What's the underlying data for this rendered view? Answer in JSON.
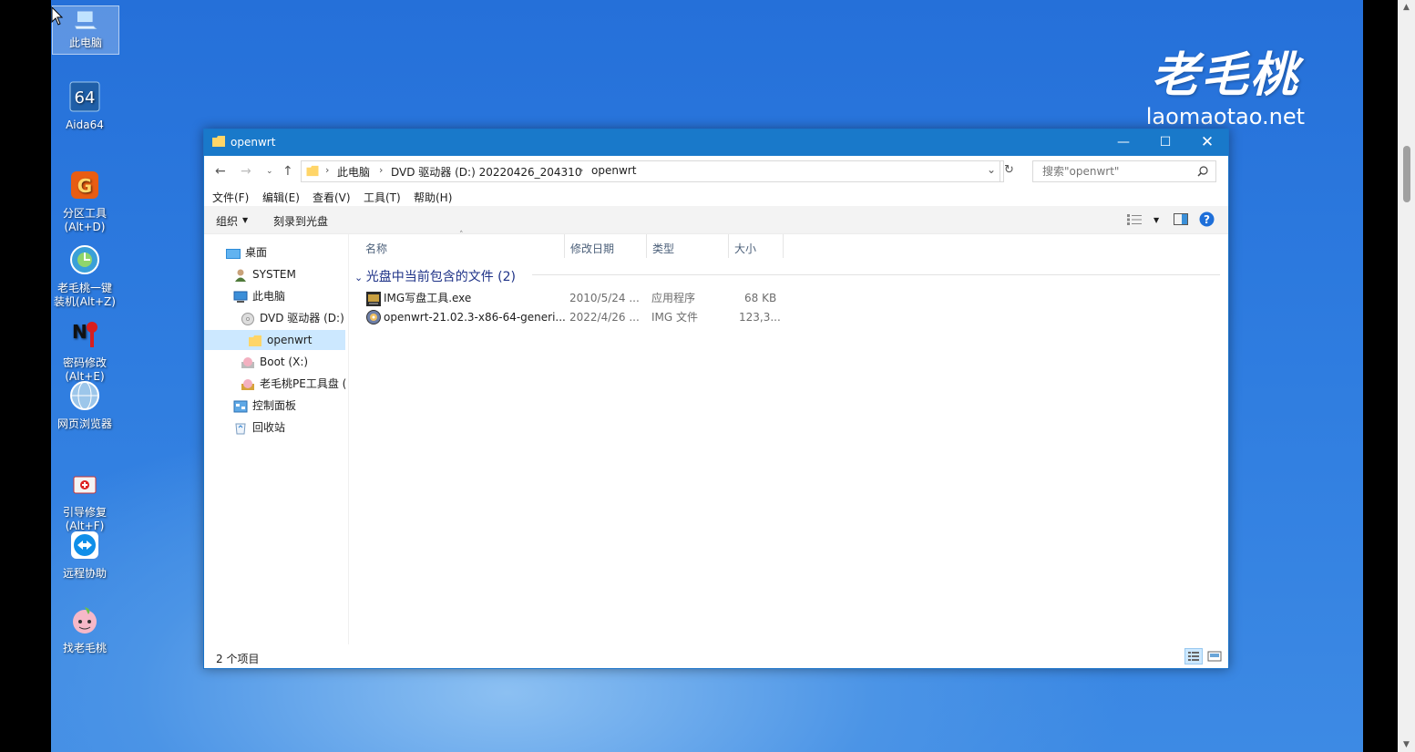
{
  "desktop": {
    "icons": [
      {
        "label": "此电脑",
        "icon": "this-pc-icon"
      },
      {
        "label": "Aida64",
        "icon": "aida64-icon"
      },
      {
        "label": "分区工具\n(Alt+D)",
        "icon": "partition-tool-icon"
      },
      {
        "label": "老毛桃一键\n装机(Alt+Z)",
        "icon": "one-key-install-icon"
      },
      {
        "label": "密码修改\n(Alt+E)",
        "icon": "password-change-icon"
      },
      {
        "label": "网页浏览器",
        "icon": "web-browser-icon"
      },
      {
        "label": "引导修复\n(Alt+F)",
        "icon": "boot-repair-icon"
      },
      {
        "label": "远程协助",
        "icon": "remote-assist-icon"
      },
      {
        "label": "找老毛桃",
        "icon": "find-laomaotao-icon"
      }
    ],
    "brand_cn": "老毛桃",
    "brand_url": "laomaotao.net"
  },
  "window": {
    "title": "openwrt",
    "breadcrumb": [
      "此电脑",
      "DVD 驱动器 (D:) 20220426_204310",
      "openwrt"
    ],
    "search_placeholder": "搜索\"openwrt\"",
    "menu": [
      "文件(F)",
      "编辑(E)",
      "查看(V)",
      "工具(T)",
      "帮助(H)"
    ],
    "commands": {
      "organize": "组织",
      "burn": "刻录到光盘"
    },
    "nav_tree": [
      {
        "label": "桌面",
        "icon": "desktop-folder-icon"
      },
      {
        "label": "SYSTEM",
        "icon": "user-icon"
      },
      {
        "label": "此电脑",
        "icon": "computer-icon"
      },
      {
        "label": "DVD 驱动器 (D:)",
        "icon": "dvd-drive-icon"
      },
      {
        "label": "openwrt",
        "icon": "folder-icon"
      },
      {
        "label": "Boot (X:)",
        "icon": "boot-drive-icon"
      },
      {
        "label": "老毛桃PE工具盘 (",
        "icon": "pe-drive-icon"
      },
      {
        "label": "控制面板",
        "icon": "control-panel-icon"
      },
      {
        "label": "回收站",
        "icon": "recycle-bin-icon"
      }
    ],
    "columns": {
      "name": "名称",
      "date": "修改日期",
      "type": "类型",
      "size": "大小"
    },
    "group_label": "光盘中当前包含的文件 (2)",
    "files": [
      {
        "name": "IMG写盘工具.exe",
        "date": "2010/5/24 ...",
        "type": "应用程序",
        "size": "68 KB",
        "icon": "img-writer-exe-icon"
      },
      {
        "name": "openwrt-21.02.3-x86-64-generi...",
        "date": "2022/4/26 ...",
        "type": "IMG 文件",
        "size": "123,3...",
        "icon": "img-file-icon"
      }
    ],
    "status": "2 个项目",
    "colors": {
      "titlebar": "#1979ca",
      "selection": "#cce8ff",
      "group_text": "#1e3287"
    }
  }
}
